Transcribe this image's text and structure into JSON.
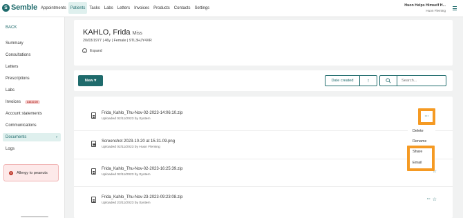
{
  "app": {
    "logo_text": "Semble",
    "logo_mark": "S"
  },
  "nav": {
    "items": [
      {
        "label": "Appointments",
        "active": false
      },
      {
        "label": "Patients",
        "active": true
      },
      {
        "label": "Tasks",
        "active": false
      },
      {
        "label": "Labs",
        "active": false
      },
      {
        "label": "Letters",
        "active": false
      },
      {
        "label": "Invoices",
        "active": false
      },
      {
        "label": "Products",
        "active": false
      },
      {
        "label": "Contacts",
        "active": false
      },
      {
        "label": "Settings",
        "active": false
      }
    ]
  },
  "user": {
    "org": "Huon Helps Himself H...",
    "name": "Huon Fleming"
  },
  "sidebar": {
    "back": "BACK",
    "items": [
      {
        "label": "Summary"
      },
      {
        "label": "Consultations"
      },
      {
        "label": "Letters"
      },
      {
        "label": "Prescriptions"
      },
      {
        "label": "Labs"
      },
      {
        "label": "Invoices",
        "badge": "£4610.00"
      },
      {
        "label": "Account statements"
      },
      {
        "label": "Communications"
      },
      {
        "label": "Documents",
        "active": true
      },
      {
        "label": "Logs"
      }
    ],
    "allergy": "Allergy to peanuts",
    "allergy_icon": "!"
  },
  "patient": {
    "name": "KAHLO, Frida",
    "title": "Miss",
    "details": "20/03/1977  |  46y  |  Female  |  9TL3HJY4XR",
    "expand": "Expand"
  },
  "toolbar": {
    "new_label": "New",
    "date_label": "Date created",
    "sort_icon": "↑",
    "search_placeholder": "Search..."
  },
  "documents": [
    {
      "name": "Frida_Kahlo_Thu-Nov-02-2023-14:06:10.zip",
      "uploaded": "Uploaded 02/11/2023 by System",
      "type": "doc"
    },
    {
      "name": "Screenshot 2023-10-20 at 15.31.09.png",
      "uploaded": "Uploaded 02/11/2023 by Huon Fleming",
      "type": "img"
    },
    {
      "name": "Frida_Kahlo_Thu-Nov-02-2023-16:25:39.zip",
      "uploaded": "Uploaded 02/11/2023 by System",
      "type": "doc"
    },
    {
      "name": "Frida_Kahlo_Thu-Nov-23-2023-09:23:08.zip",
      "uploaded": "Uploaded 23/11/2023 by System",
      "type": "doc"
    }
  ],
  "row_menu": {
    "dots": "···",
    "star": "☆",
    "items": [
      "Delete",
      "Rename",
      "Share",
      "Email"
    ]
  },
  "colors": {
    "accent": "#1f6b6c",
    "highlight": "#f59a23",
    "alert": "#c0392b"
  }
}
